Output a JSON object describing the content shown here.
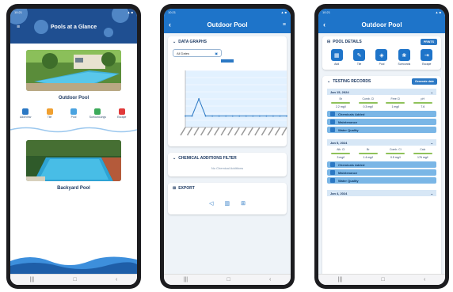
{
  "phone1": {
    "title": "Pools at a Glance",
    "pools": [
      {
        "name": "Outdoor Pool"
      },
      {
        "name": "Backyard Pool"
      }
    ],
    "actions": [
      {
        "label": "Add/View",
        "icon": "beaker-icon",
        "color": "#2b78c4"
      },
      {
        "label": "Tile",
        "icon": "brush-icon",
        "color": "#f0a030"
      },
      {
        "label": "Pool",
        "icon": "pool-icon",
        "color": "#4aa3e0"
      },
      {
        "label": "Surround-ings",
        "icon": "leaf-icon",
        "color": "#3caa5a"
      },
      {
        "label": "Escape",
        "icon": "exit-icon",
        "color": "#e03a3a"
      }
    ]
  },
  "phone2": {
    "title": "Outdoor Pool",
    "data_graphs": "DATA GRAPHS",
    "date_select": "All Dates",
    "chemical_filter": "CHEMICAL ADDITIONS FILTER",
    "chemical_empty": "No Chemical Additions",
    "export": "EXPORT",
    "chart_data": {
      "type": "line",
      "series": [
        {
          "name": "",
          "values": [
            0.8,
            0.8,
            2.0,
            0.8,
            0.8,
            0.8,
            0.8,
            0.8,
            0.8,
            0.8,
            0.8,
            0.8,
            0.8,
            0.8,
            0.8,
            0.8
          ]
        }
      ],
      "ylim": [
        0,
        4
      ],
      "color": "#2b78c4",
      "band_color": "#cfe8ff"
    }
  },
  "phone3": {
    "title": "Outdoor Pool",
    "pool_details": "POOL DETAILS",
    "print_label": "PRINTS",
    "icons": [
      {
        "label": "Add",
        "icon": "calendar-icon"
      },
      {
        "label": "Tile",
        "icon": "wrench-icon"
      },
      {
        "label": "Pool",
        "icon": "drop-icon"
      },
      {
        "label": "Surrounds",
        "icon": "leaf-icon"
      },
      {
        "label": "Escape",
        "icon": "exit-icon"
      }
    ],
    "testing_records": "TESTING RECORDS",
    "generate_btn": "Generate date",
    "records": [
      {
        "date": "Jan 15, 2024",
        "readings": [
          {
            "label": "Br",
            "value": "2.2 mg/l"
          },
          {
            "label": "Comb. Cl",
            "value": "0.3 mg/l"
          },
          {
            "label": "Free Cl",
            "value": "1 mg/l"
          },
          {
            "label": "pH",
            "value": "7.6"
          }
        ],
        "items": [
          "Chemicals Added",
          "Maintenance",
          "Water Quality"
        ]
      },
      {
        "date": "Jan 5, 2024",
        "readings": [
          {
            "label": "Alk. Cl",
            "value": "3 mg/l"
          },
          {
            "label": "Br",
            "value": "1.4 mg/l"
          },
          {
            "label": "Comb. Cl",
            "value": "0.5 mg/l"
          },
          {
            "label": "Calc",
            "value": "176 mg/l"
          }
        ],
        "items": [
          "Chemicals Added",
          "Maintenance",
          "Water Quality"
        ]
      },
      {
        "date": "Jan 4, 2024",
        "readings": [],
        "items": []
      }
    ]
  }
}
